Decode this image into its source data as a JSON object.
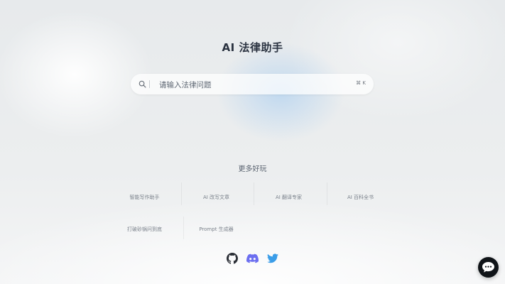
{
  "page": {
    "title": "AI 法律助手"
  },
  "search": {
    "placeholder": "请输入法律问题",
    "shortcut": "⌘ K"
  },
  "more": {
    "title": "更多好玩",
    "tools": [
      {
        "label": "智能写作助手"
      },
      {
        "label": "AI 改写文章"
      },
      {
        "label": "AI 翻译专家"
      },
      {
        "label": "AI 百科全书"
      },
      {
        "label": "打破砂锅问到底"
      },
      {
        "label": "Prompt 生成器"
      }
    ]
  },
  "social": {
    "icons": [
      "github-icon",
      "discord-icon",
      "twitter-icon"
    ],
    "colors": {
      "github": "#2b2f36",
      "discord": "#6c6ff0",
      "twitter": "#3a9de8"
    }
  },
  "chat": {
    "icon": "chat-bubble-icon",
    "color": "#101418"
  }
}
